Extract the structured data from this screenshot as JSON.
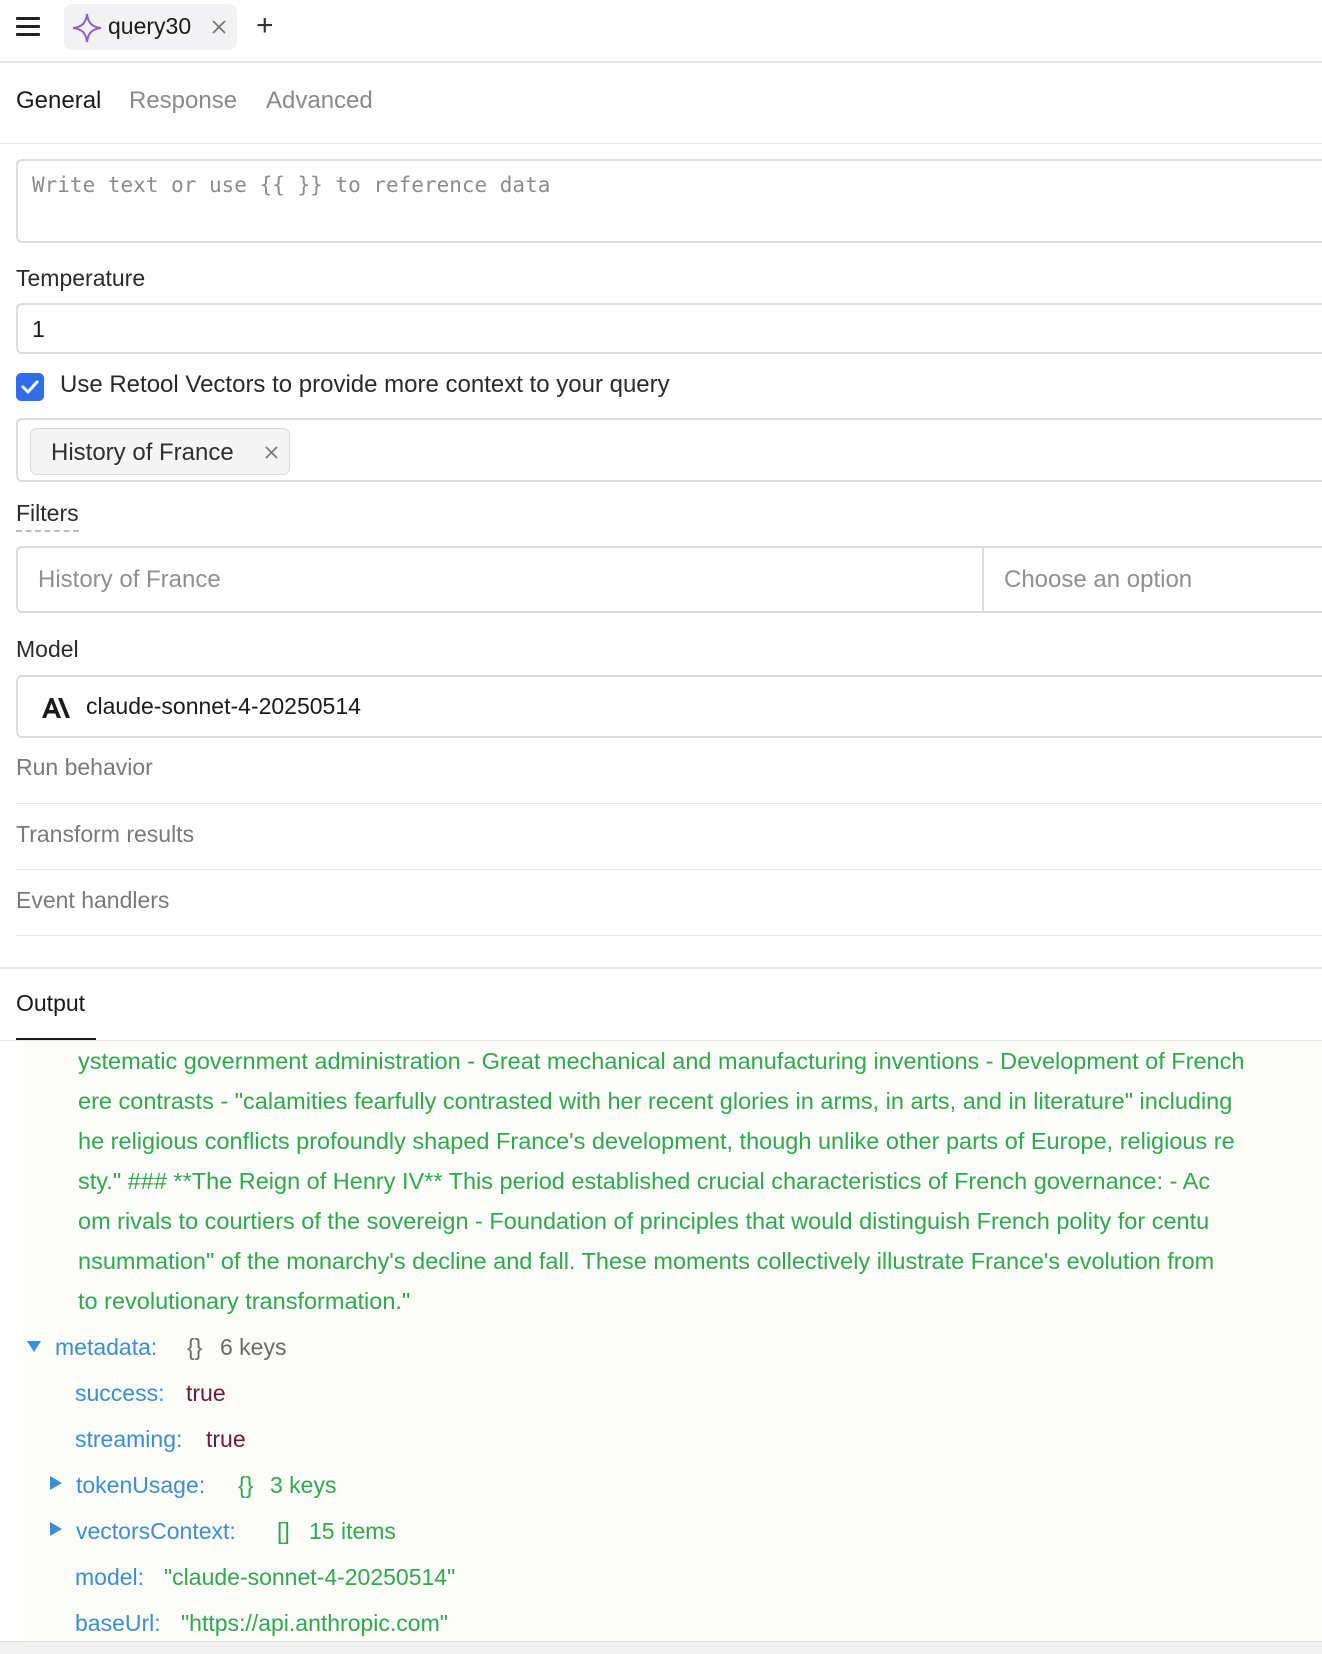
{
  "topbar": {
    "tab_name": "query30",
    "menu_icon": "hamburger-menu-icon",
    "tab_icon": "sparkle-icon",
    "close_icon": "close-icon",
    "add_icon": "plus-icon",
    "add_label": "+"
  },
  "subtabs": [
    "General",
    "Response",
    "Advanced"
  ],
  "form": {
    "message_placeholder": "Write text or use {{ }} to reference data",
    "temperature_label": "Temperature",
    "temperature_value": "1",
    "vectors_checkbox_label": "Use Retool Vectors to provide more context to your query",
    "vectors_checked": true,
    "vector_chip": "History of France",
    "filters_label": "Filters",
    "filter_value": "History of France",
    "filter_option_placeholder": "Choose an option",
    "model_label": "Model",
    "model_value": "claude-sonnet-4-20250514",
    "model_icon": "anthropic-logo-icon",
    "sections": [
      "Run behavior",
      "Transform results",
      "Event handlers"
    ]
  },
  "output": {
    "tab_label": "Output",
    "text_lines": [
      "ystematic government administration - Great mechanical and manufacturing inventions - Development of French",
      "ere contrasts - \"calamities fearfully contrasted with her recent glories in arms, in arts, and in literature\" including",
      "he religious conflicts profoundly shaped France's development, though unlike other parts of Europe, religious re",
      "sty.\" ### **The Reign of Henry IV** This period established crucial characteristics of French governance: - Ac",
      "om rivals to courtiers of the sovereign - Foundation of principles that would distinguish French polity for centu",
      "nsummation\" of the monarchy's decline and fall. These moments collectively illustrate France's evolution from",
      "to revolutionary transformation.\""
    ],
    "metadata": {
      "key": "metadata:",
      "braces": "{}",
      "count": "6 keys",
      "success_key": "success:",
      "success_val": "true",
      "streaming_key": "streaming:",
      "streaming_val": "true",
      "tokenUsage_key": "tokenUsage:",
      "tokenUsage_braces": "{}",
      "tokenUsage_count": "3 keys",
      "vectorsContext_key": "vectorsContext:",
      "vectorsContext_brackets": "[]",
      "vectorsContext_count": "15 items",
      "model_key": "model:",
      "model_val": "\"claude-sonnet-4-20250514\"",
      "baseUrl_key": "baseUrl:",
      "baseUrl_val": "\"https://api.anthropic.com\""
    }
  },
  "colors": {
    "accent": "#2f6ee8",
    "string_green": "#2fa84f",
    "key_blue": "#3b8ed6",
    "bool_maroon": "#6b1a3a",
    "tab_sparkle": "#8a63d2"
  }
}
